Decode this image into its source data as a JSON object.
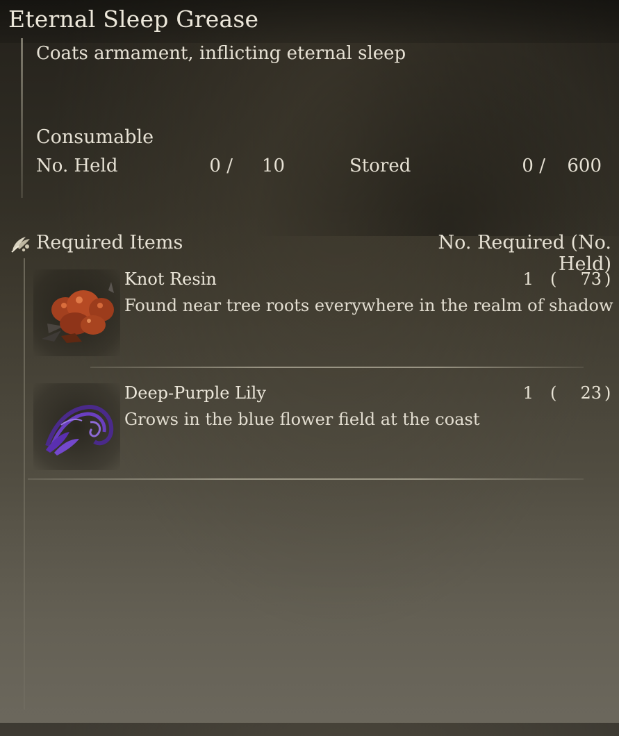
{
  "item": {
    "title": "Eternal Sleep Grease",
    "description": "Coats armament, inflicting eternal sleep",
    "type": "Consumable",
    "held_label": "No. Held",
    "held_current": "0 /",
    "held_max": "10",
    "stored_label": "Stored",
    "stored_current": "0 /",
    "stored_max": "600"
  },
  "required": {
    "icon": "crafting-materials-icon",
    "label": "Required Items",
    "columns_label": "No. Required (No. Held)",
    "materials": [
      {
        "name": "Knot Resin",
        "description": "Found near tree roots everywhere in the realm of shadow",
        "required": "1",
        "paren_open": "(",
        "held": "73",
        "paren_close": ")",
        "icon": "knot-resin-icon"
      },
      {
        "name": "Deep-Purple Lily",
        "description": "Grows in the blue flower field at the coast",
        "required": "1",
        "paren_open": "(",
        "held": "23",
        "paren_close": ")",
        "icon": "deep-purple-lily-icon"
      }
    ]
  },
  "colors": {
    "text": "#e6e1d4",
    "background_top": "#24211b",
    "background_bottom": "#6a665b"
  }
}
